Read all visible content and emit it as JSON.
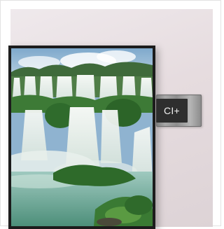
{
  "product_image": {
    "screen_scene": "waterfall-landscape",
    "module": {
      "label": "CI+"
    }
  }
}
